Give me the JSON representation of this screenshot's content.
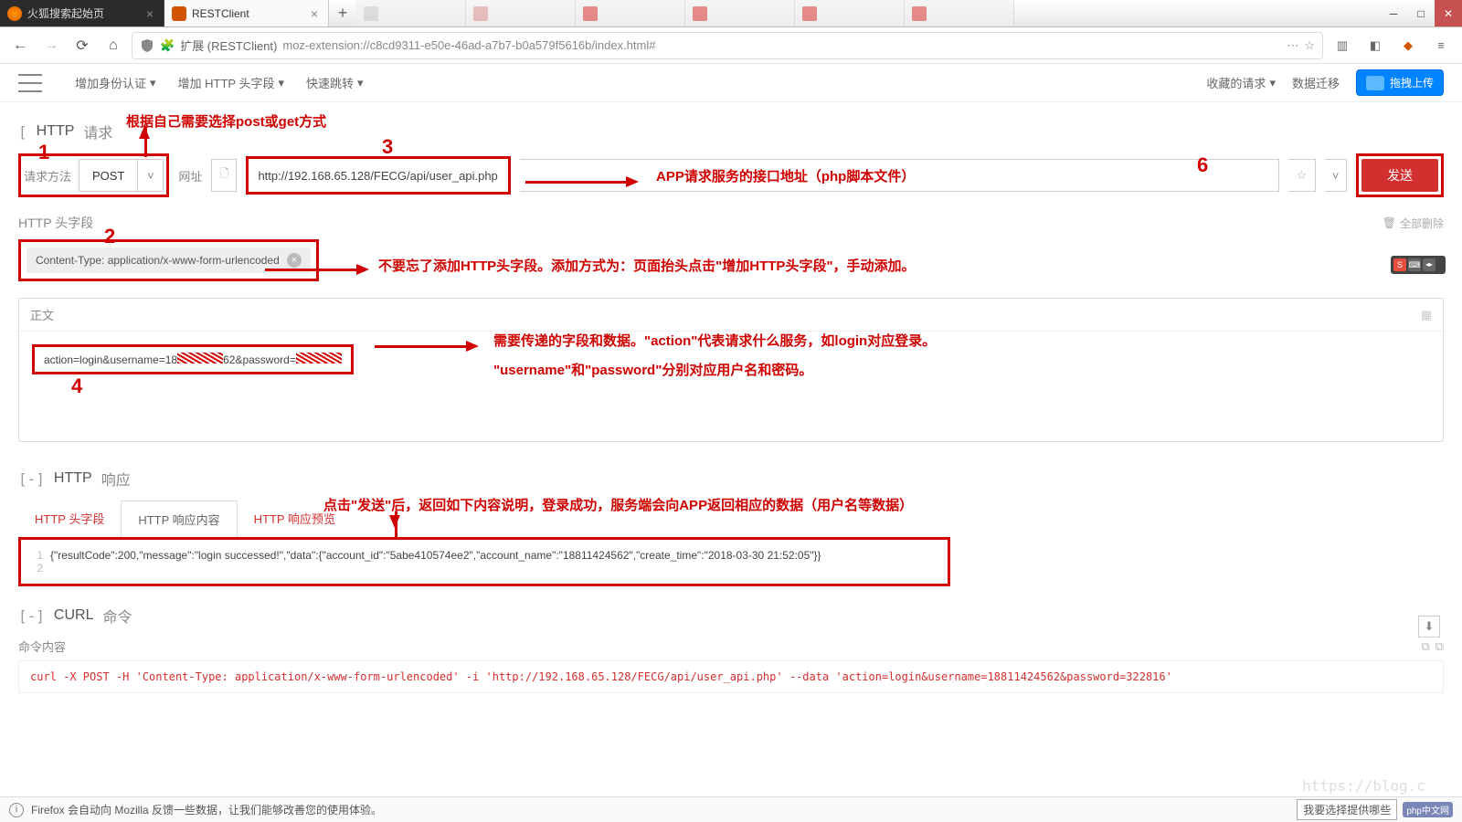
{
  "browser": {
    "tabs": [
      {
        "label": "火狐搜索起始页",
        "dark": true
      },
      {
        "label": "RESTClient",
        "active": true
      }
    ],
    "source": "扩展 (RESTClient)",
    "url": "moz-extension://c8cd9311-e50e-46ad-a7b7-b0a579f5616b/index.html#"
  },
  "menubar": {
    "auth": "增加身份认证",
    "headers": "增加 HTTP 头字段",
    "jump": "快速跳转",
    "favorites": "收藏的请求",
    "migrate": "数据迁移",
    "drag_upload": "拖拽上传"
  },
  "request": {
    "section_toggle": "[",
    "section_title_http": "HTTP",
    "section_title_req": "请求",
    "method_label": "请求方法",
    "method_value": "POST",
    "url_label": "网址",
    "url_value": "http://192.168.65.128/FECG/api/user_api.php",
    "send": "发送"
  },
  "headers": {
    "title": "HTTP 头字段",
    "chip": "Content-Type: application/x-www-form-urlencoded",
    "clear_all": "全部删除"
  },
  "body": {
    "title": "正文",
    "content_prefix": "action=login&username=18",
    "content_mid": "62&password=",
    "content_suffix": ""
  },
  "response": {
    "section_toggle": "[-]",
    "section_title": "HTTP",
    "section_sub": "响应",
    "tab_headers": "HTTP 头字段",
    "tab_body": "HTTP 响应内容",
    "tab_preview": "HTTP 响应预览",
    "content": "{\"resultCode\":200,\"message\":\"login successed!\",\"data\":{\"account_id\":\"5abe410574ee2\",\"account_name\":\"18811424562\",\"create_time\":\"2018-03-30 21:52:05\"}}"
  },
  "curl": {
    "section_toggle": "[-]",
    "section_title": "CURL",
    "section_sub": "命令",
    "label": "命令内容",
    "content": "curl -X POST -H 'Content-Type: application/x-www-form-urlencoded' -i 'http://192.168.65.128/FECG/api/user_api.php' --data 'action=login&username=18811424562&password=322816'"
  },
  "annotations": {
    "n1": "1",
    "n2": "2",
    "n3": "3",
    "n4": "4",
    "n6": "6",
    "a_method": "根据自己需要选择post或get方式",
    "a_url": "APP请求服务的接口地址（php脚本文件）",
    "a_header": "不要忘了添加HTTP头字段。添加方式为：页面抬头点击\"增加HTTP头字段\"，手动添加。",
    "a_body1": "需要传递的字段和数据。\"action\"代表请求什么服务，如login对应登录。",
    "a_body2": "\"username\"和\"password\"分别对应用户名和密码。",
    "a_resp": "点击\"发送\"后，返回如下内容说明，登录成功，服务端会向APP返回相应的数据（用户名等数据）"
  },
  "statusbar": {
    "text": "Firefox 会自动向 Mozilla 反馈一些数据，让我们能够改善您的使用体验。",
    "rbox": "我要选择提供哪些",
    "logo": "php中文网"
  },
  "watermark": "https://blog.c"
}
